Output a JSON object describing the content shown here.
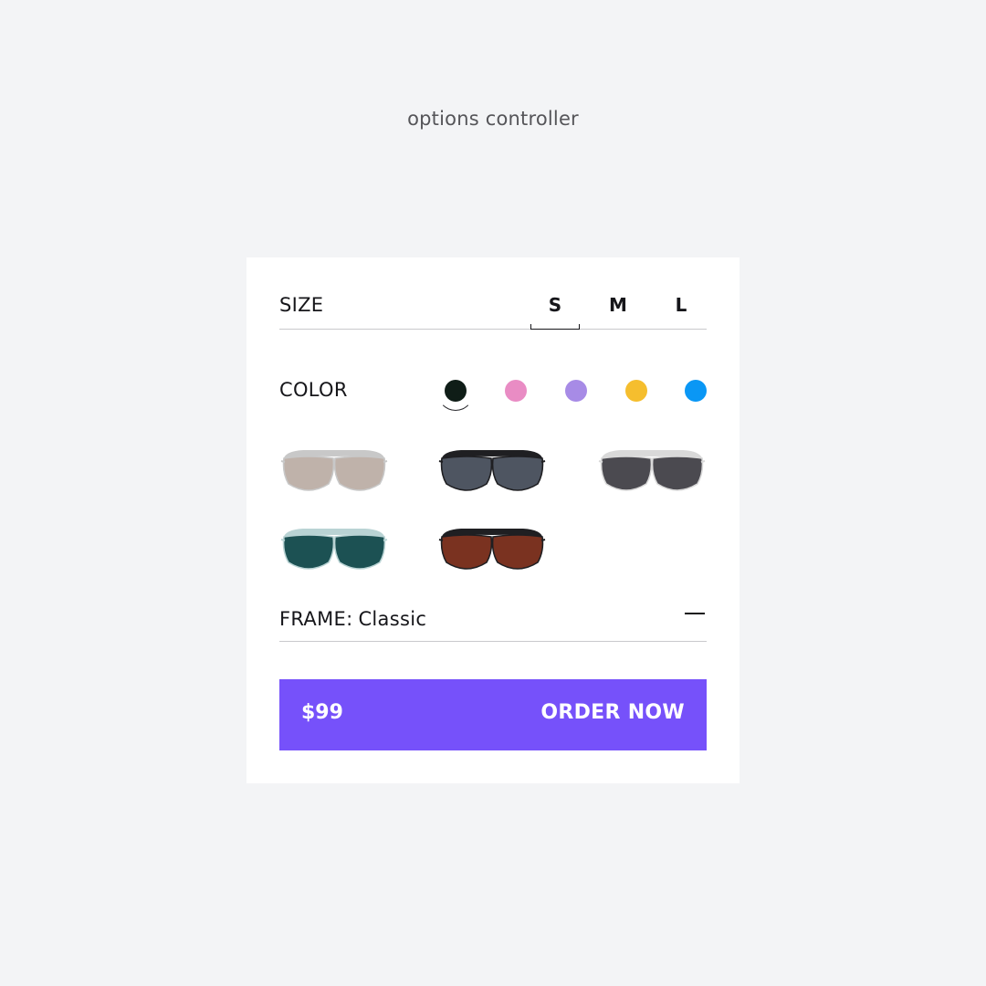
{
  "page_title": "options controller",
  "size": {
    "label": "SIZE",
    "options": [
      "S",
      "M",
      "L"
    ],
    "selected": "S"
  },
  "color": {
    "label": "COLOR",
    "swatches": [
      {
        "name": "black",
        "hex": "#0f1d17"
      },
      {
        "name": "pink",
        "hex": "#e98cc4"
      },
      {
        "name": "lavender",
        "hex": "#a78be6"
      },
      {
        "name": "yellow",
        "hex": "#f5be2e"
      },
      {
        "name": "blue",
        "hex": "#0a97f5"
      }
    ],
    "selected": "black"
  },
  "glasses": [
    {
      "frame": "#c8c8c8",
      "lens": "#bfb2aa"
    },
    {
      "frame": "#1f1f22",
      "lens": "#4e5561"
    },
    {
      "frame": "#d9d9d9",
      "lens": "#4b4a50"
    },
    {
      "frame": "#b9d3d4",
      "lens": "#1c5153"
    },
    {
      "frame": "#1f1f22",
      "lens": "#7a3220"
    }
  ],
  "frame": {
    "label": "FRAME:",
    "value": "Classic"
  },
  "order": {
    "price": "$99",
    "label": "ORDER NOW",
    "color": "#7651fa"
  }
}
